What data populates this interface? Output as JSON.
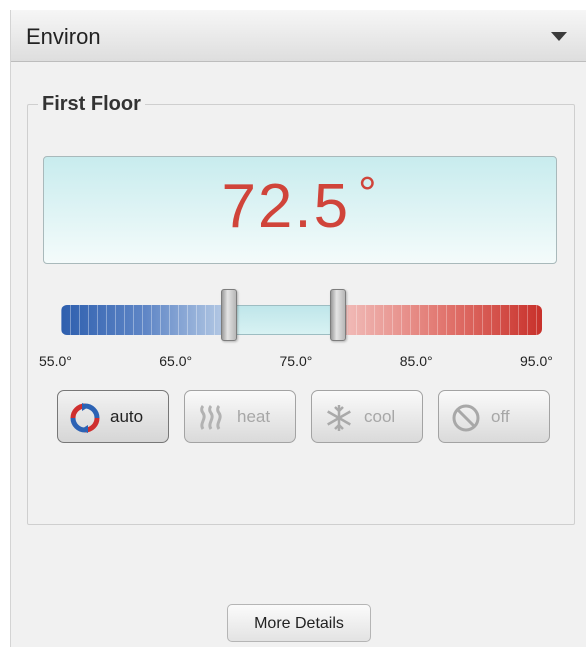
{
  "panel": {
    "title": "Environ",
    "collapse_icon": "caret-down-icon"
  },
  "zone": {
    "name": "First Floor",
    "current_temp": "72.5",
    "degree_symbol": "°"
  },
  "range_slider": {
    "scale_labels": [
      "55.0°",
      "65.0°",
      "75.0°",
      "85.0°",
      "95.0°"
    ],
    "min": 55.0,
    "max": 95.0,
    "low_setpoint": 69.0,
    "high_setpoint": 78.0,
    "colors": {
      "cool": "#2e5fae",
      "warm": "#c8312b",
      "neutral": "#c8ecee"
    }
  },
  "modes": [
    {
      "label": "auto",
      "icon": "auto-cycle-icon",
      "active": true
    },
    {
      "label": "heat",
      "icon": "heat-waves-icon",
      "active": false
    },
    {
      "label": "cool",
      "icon": "snowflake-icon",
      "active": false
    },
    {
      "label": "off",
      "icon": "power-off-icon",
      "active": false
    }
  ],
  "more_details_label": "More Details",
  "colors": {
    "temp_text": "#d0443a",
    "display_bg": "#c8ecee"
  }
}
